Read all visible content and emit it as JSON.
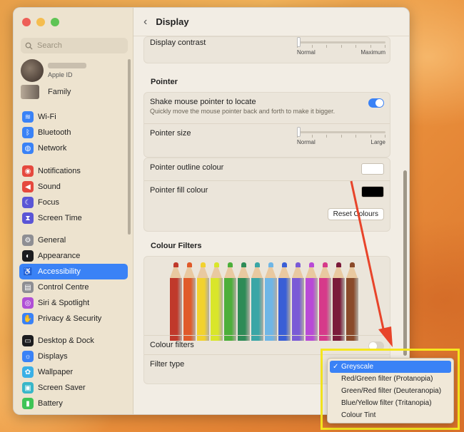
{
  "window": {
    "title": "Display"
  },
  "sidebar": {
    "search_placeholder": "Search",
    "account_sub": "Apple ID",
    "family": "Family",
    "groups": [
      [
        {
          "label": "Wi-Fi",
          "icon": "wifi-icon",
          "color": "#3a82f6"
        },
        {
          "label": "Bluetooth",
          "icon": "bluetooth-icon",
          "color": "#3a82f6"
        },
        {
          "label": "Network",
          "icon": "globe-icon",
          "color": "#3a82f6"
        }
      ],
      [
        {
          "label": "Notifications",
          "icon": "bell-icon",
          "color": "#e5483d"
        },
        {
          "label": "Sound",
          "icon": "speaker-icon",
          "color": "#e5483d"
        },
        {
          "label": "Focus",
          "icon": "moon-icon",
          "color": "#5a55d6"
        },
        {
          "label": "Screen Time",
          "icon": "hourglass-icon",
          "color": "#5a55d6"
        }
      ],
      [
        {
          "label": "General",
          "icon": "gear-icon",
          "color": "#8e8e93"
        },
        {
          "label": "Appearance",
          "icon": "appearance-icon",
          "color": "#1c1c1e"
        },
        {
          "label": "Accessibility",
          "icon": "accessibility-icon",
          "color": "#3a82f6",
          "active": true
        },
        {
          "label": "Control Centre",
          "icon": "control-centre-icon",
          "color": "#8e8e93"
        },
        {
          "label": "Siri & Spotlight",
          "icon": "siri-icon",
          "color": "#b04fd6"
        },
        {
          "label": "Privacy & Security",
          "icon": "hand-icon",
          "color": "#3a82f6"
        }
      ],
      [
        {
          "label": "Desktop & Dock",
          "icon": "dock-icon",
          "color": "#1c1c1e"
        },
        {
          "label": "Displays",
          "icon": "sun-icon",
          "color": "#3a82f6"
        },
        {
          "label": "Wallpaper",
          "icon": "flower-icon",
          "color": "#3ab0e6"
        },
        {
          "label": "Screen Saver",
          "icon": "screensaver-icon",
          "color": "#38b6c8"
        },
        {
          "label": "Battery",
          "icon": "battery-icon",
          "color": "#3ec456"
        }
      ]
    ]
  },
  "main": {
    "display_contrast": "Display contrast",
    "contrast_min": "Normal",
    "contrast_max": "Maximum",
    "pointer_header": "Pointer",
    "shake_label": "Shake mouse pointer to locate",
    "shake_sub": "Quickly move the mouse pointer back and forth to make it bigger.",
    "shake_on": true,
    "pointer_size": "Pointer size",
    "size_min": "Normal",
    "size_max": "Large",
    "outline_label": "Pointer outline colour",
    "outline_color": "#ffffff",
    "fill_label": "Pointer fill colour",
    "fill_color": "#000000",
    "reset_button": "Reset Colours",
    "filters_header": "Colour Filters",
    "filters_label": "Colour filters",
    "filters_on": false,
    "filter_type_label": "Filter type",
    "pencil_colors": [
      "#c0392b",
      "#e05a2a",
      "#f2d22e",
      "#d9e62a",
      "#4caf3a",
      "#2e8b57",
      "#3aa6a6",
      "#6fb6e6",
      "#3a5fd6",
      "#7a5ad6",
      "#b84ad6",
      "#d63a8a",
      "#7a1a3a",
      "#8a4a2a"
    ]
  },
  "dropdown": {
    "options": [
      "Greyscale",
      "Red/Green filter (Protanopia)",
      "Green/Red filter (Deuteranopia)",
      "Blue/Yellow filter (Tritanopia)",
      "Colour Tint"
    ],
    "selected": "Greyscale"
  },
  "annotation": {
    "highlight_color": "#f5e61e",
    "arrow_color": "#e8442a"
  }
}
